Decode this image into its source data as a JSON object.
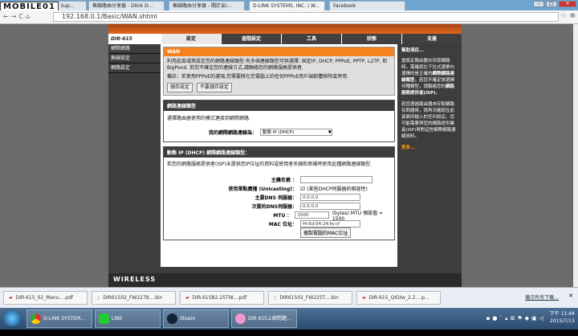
{
  "browser": {
    "tabs": [
      "D-Link Technical Sup...",
      "無線路由分享器 - Dlink D...",
      "無線路由分享器 - 關於友I...",
      "D-LINK SYSTEMS, INC. | W...",
      "Facebook"
    ],
    "active_tab": 3,
    "url": "192.168.0.1/Basic/WAN.shtml",
    "watermark": "MOBILE01"
  },
  "router": {
    "model": "DIR-615",
    "nav": [
      "設定",
      "進階設定",
      "工具",
      "狀態",
      "支援"
    ],
    "sidebar": [
      "網際網路",
      "無線設定",
      "網路設定"
    ],
    "wan": {
      "title": "WAN",
      "desc": "利用此區域來設定您的網路連線類型.有多個連線類型可供選擇: 固定IP, DHCP, PPPoE, PPTP, L2TP, 和 BigPond. 若您不確定您的連線方式,請聯絡您的網路服務提供者.",
      "note": "備註：若使用PPPoE的選項,您需要將在您電腦上的任何PPPoE用戶端軟體移除或停用.",
      "save": "儲存設定",
      "dont_save": "不要儲存設定"
    },
    "conn": {
      "title": "網路連線類型",
      "desc": "選擇路由器使用的模式連接到網際網路.",
      "label": "我的網際網路連線為：",
      "value": "動態 IP (DHCP)"
    },
    "dhcp": {
      "title": "動態 IP (DHCP) 網際網路連線類型：",
      "desc": "若您的網路服務提供者(ISP)未提供您IP位址的資料或使用者名稱和密碼時使用此種網路連線類型.",
      "host_label": "主機名稱 ：",
      "host_value": "",
      "unicast_label": "使用單點廣播 (Unicasting)：",
      "unicast_note": "(某些DHCP伺服器的相容性)",
      "unicast_checked": true,
      "dns1_label": "主要DNS 伺服器：",
      "dns1": "0.0.0.0",
      "dns2_label": "次要的DNS伺服器：",
      "dns2": "0.0.0.0",
      "mtu_label": "MTU ：",
      "mtu": "1500",
      "mtu_note": "(bytes) MTU 預設值 = 1500",
      "mac_label": "MAC 位址：",
      "mac": "f4:6d:04:24:fe:cf",
      "clone": "複製電腦的MAC位址"
    },
    "help": {
      "title": "幫助項目...",
      "p1": "當設定路由器去存取網路時，需確認在下拉式選單內選擇的是正確的",
      "p1b": "網際網路連線類型",
      "p1c": "。若您不確定該選擇何種類型，請聯絡您的",
      "p1d": "網路服務提供者(ISP)",
      "p1e": "。",
      "p2": "若您透過路由器來存取網路有問題時，請再次確認在此頁面所輸入的任何設定。您可能需要與您的網路提供業者(ISP)再對這些網際網路連線資料。",
      "more": "更多..."
    },
    "footer": "WIRELESS"
  },
  "downloads": {
    "items": [
      "DIR-615_02_Manu....pdf",
      "DIR61502_FW2278....bin",
      "DIR-615B2.25TW....pdf",
      "DIR61502_FW225T....bin",
      "DIR-615_QIGtw_2.2....p..."
    ],
    "show_all": "顯示所有下載..."
  },
  "taskbar": {
    "items": [
      "D-LINK SYSTEM...",
      "LINE",
      "Steam",
      "DIR 615上網問題..."
    ],
    "time": "下午 11:44",
    "date": "2015/7/13"
  }
}
